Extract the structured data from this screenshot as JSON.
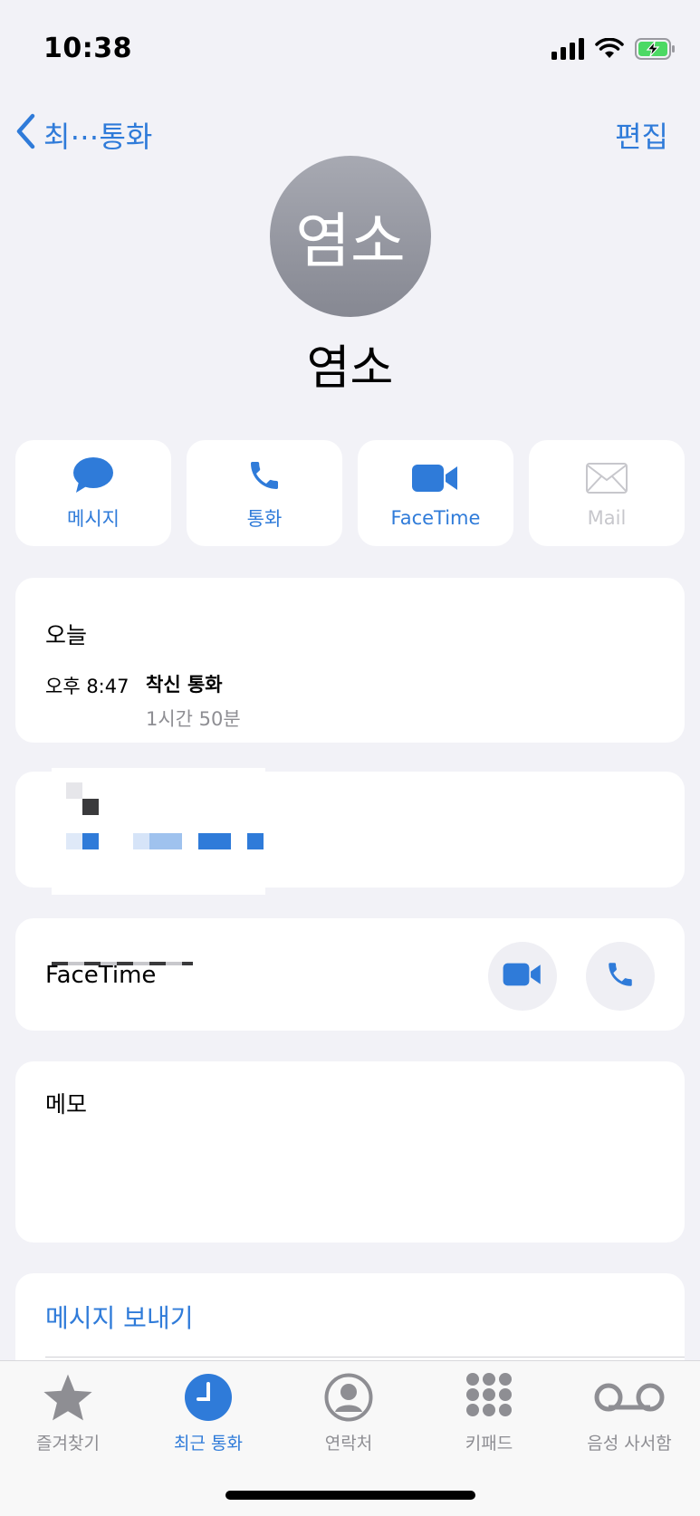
{
  "status_bar": {
    "time": "10:38",
    "icons": [
      "signal-icon",
      "wifi-icon",
      "battery-charging-icon"
    ]
  },
  "nav": {
    "back_label": "최⋯통화",
    "edit_label": "편집"
  },
  "contact": {
    "avatar_text": "염소",
    "name": "염소"
  },
  "actions": [
    {
      "label": "메시지",
      "icon": "message-icon",
      "enabled": true
    },
    {
      "label": "통화",
      "icon": "phone-icon",
      "enabled": true
    },
    {
      "label": "FaceTime",
      "icon": "video-icon",
      "enabled": true
    },
    {
      "label": "Mail",
      "icon": "mail-icon",
      "enabled": false
    }
  ],
  "recent": {
    "title": "오늘",
    "time": "오후 8:47",
    "type": "착신 통화",
    "duration": "1시간 50분"
  },
  "facetime": {
    "label": "FaceTime"
  },
  "notes": {
    "label": "메모"
  },
  "send_message": {
    "label": "메시지 보내기"
  },
  "tabs": [
    {
      "label": "즐겨찾기",
      "icon": "star-icon",
      "active": false
    },
    {
      "label": "최근 통화",
      "icon": "clock-icon",
      "active": true
    },
    {
      "label": "연락처",
      "icon": "person-circle-icon",
      "active": false
    },
    {
      "label": "키패드",
      "icon": "keypad-icon",
      "active": false
    },
    {
      "label": "음성 사서함",
      "icon": "voicemail-icon",
      "active": false
    }
  ],
  "colors": {
    "accent": "#2f7bd9",
    "background": "#f2f2f7",
    "disabled": "#c7c7cc",
    "secondary": "#8e8e93"
  }
}
